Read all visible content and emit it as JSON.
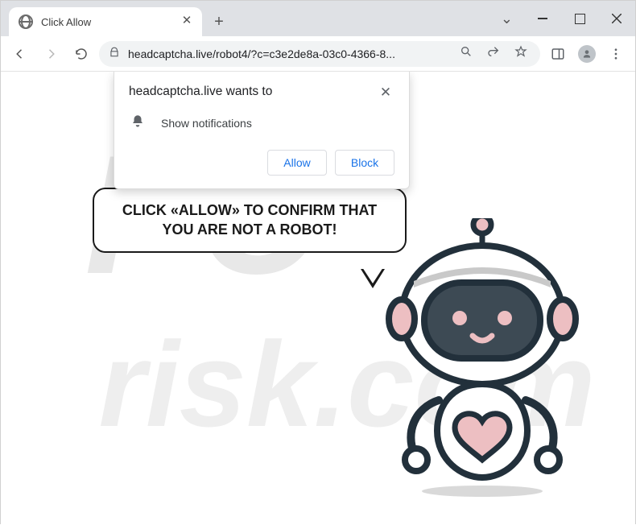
{
  "window": {
    "tab_title": "Click Allow",
    "url_display": "headcaptcha.live/robot4/?c=c3e2de8a-03c0-4366-8..."
  },
  "permission": {
    "origin_line": "headcaptcha.live wants to",
    "capability_label": "Show notifications",
    "allow_label": "Allow",
    "block_label": "Block"
  },
  "page": {
    "speech_text": "CLICK «ALLOW» TO CONFIRM THAT YOU ARE NOT A ROBOT!"
  },
  "colors": {
    "robot_outline": "#22303b",
    "robot_pink": "#edbfc2",
    "robot_visor": "#3d4a54",
    "link_blue": "#1a73e8"
  },
  "watermark": {
    "text_top": "PC",
    "text_bottom": "risk.com"
  }
}
